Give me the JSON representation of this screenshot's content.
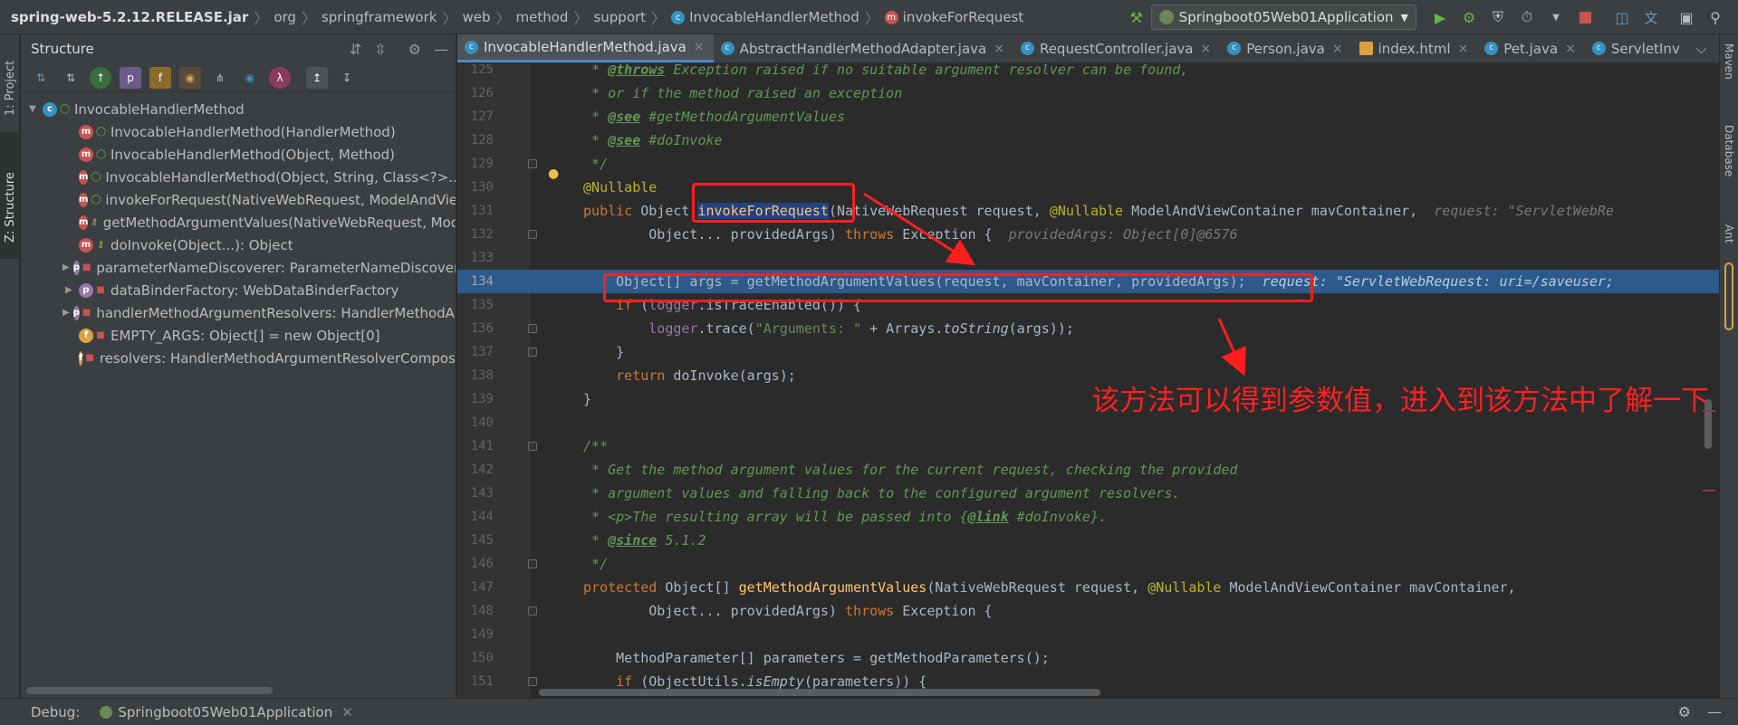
{
  "breadcrumbs": [
    "spring-web-5.2.12.RELEASE.jar",
    "org",
    "springframework",
    "web",
    "method",
    "support",
    "InvocableHandlerMethod",
    "invokeForRequest"
  ],
  "run_config": "Springboot05Web01Application",
  "left_tabs": [
    "1: Project",
    "Z: Structure"
  ],
  "right_tabs": [
    "Maven",
    "Database",
    "Ant"
  ],
  "structure": {
    "title": "Structure",
    "root": "InvocableHandlerMethod",
    "items": [
      {
        "badge": "m",
        "access": "public",
        "label": "InvocableHandlerMethod(HandlerMethod)"
      },
      {
        "badge": "m",
        "access": "public",
        "label": "InvocableHandlerMethod(Object, Method)"
      },
      {
        "badge": "m",
        "access": "public",
        "label": "InvocableHandlerMethod(Object, String, Class<?>...)"
      },
      {
        "badge": "m",
        "access": "public",
        "label": "invokeForRequest(NativeWebRequest, ModelAndViewContainer, Object...): Object"
      },
      {
        "badge": "m",
        "access": "protected",
        "label": "getMethodArgumentValues(NativeWebRequest, ModelAndViewContainer, Object...): Object[]"
      },
      {
        "badge": "m",
        "access": "protected",
        "label": "doInvoke(Object...): Object"
      },
      {
        "badge": "p",
        "access": "private",
        "label": "parameterNameDiscoverer: ParameterNameDiscoverer",
        "expandable": true
      },
      {
        "badge": "p",
        "access": "private",
        "label": "dataBinderFactory: WebDataBinderFactory",
        "expandable": true
      },
      {
        "badge": "p",
        "access": "private",
        "label": "handlerMethodArgumentResolvers: HandlerMethodArgumentResolverComposite",
        "expandable": true
      },
      {
        "badge": "f",
        "access": "private-static",
        "label": "EMPTY_ARGS: Object[] = new Object[0]"
      },
      {
        "badge": "f",
        "access": "private",
        "label": "resolvers: HandlerMethodArgumentResolverComposite"
      }
    ]
  },
  "tabs": [
    {
      "label": "InvocableHandlerMethod.java",
      "active": true
    },
    {
      "label": "AbstractHandlerMethodAdapter.java",
      "active": false
    },
    {
      "label": "RequestController.java",
      "active": false
    },
    {
      "label": "Person.java",
      "active": false
    },
    {
      "label": "index.html",
      "active": false
    },
    {
      "label": "Pet.java",
      "active": false
    },
    {
      "label": "ServletInv",
      "active": false
    }
  ],
  "editor": {
    "lines": [
      {
        "n": "125",
        "html": "<span class=\"cmt\">  * <span class=\"tag\">@throws</span> Exception raised if no suitable argument resolver can be found,</span>"
      },
      {
        "n": "126",
        "html": "<span class=\"cmt\">  * or if the method raised an exception</span>"
      },
      {
        "n": "127",
        "html": "<span class=\"cmt\">  * <span class=\"tag\">@see</span> #getMethodArgumentValues</span>"
      },
      {
        "n": "128",
        "html": "<span class=\"cmt\">  * <span class=\"tag\">@see</span> #doInvoke</span>"
      },
      {
        "n": "129",
        "html": "<span class=\"cmt\">  */</span>"
      },
      {
        "n": "130",
        "html": " <span class=\"ann\">@Nullable</span>"
      },
      {
        "n": "131",
        "html": " <span class=\"kw\">public</span> Object <span class=\"fn sel-word\">invokeForRequest</span>(NativeWebRequest request, <span class=\"ann\">@Nullable</span> ModelAndViewContainer mavContainer,  <span class=\"inl\">request: \"ServletWebRe</span>"
      },
      {
        "n": "132",
        "html": "         Object... providedArgs) <span class=\"kw\">throws</span> Exception {  <span class=\"inl\">providedArgs: Object[0]@6576</span>"
      },
      {
        "n": "133",
        "html": ""
      },
      {
        "n": "134",
        "html": "     Object[] args = getMethodArgumentValues(request, mavContainer, providedArgs);  <span class=\"inl-hl\">request: \"ServletWebRequest: uri=/saveuser;</span>",
        "highlight": true
      },
      {
        "n": "135",
        "html": "     <span class=\"kw\">if</span> (<span class=\"fld\">logger</span>.isTraceEnabled()) {"
      },
      {
        "n": "136",
        "html": "         <span class=\"fld\">logger</span>.trace(<span class=\"str\">\"Arguments: \"</span> + Arrays.<span class=\"ital\">toString</span>(args));"
      },
      {
        "n": "137",
        "html": "     }"
      },
      {
        "n": "138",
        "html": "     <span class=\"kw\">return</span> doInvoke(args);"
      },
      {
        "n": "139",
        "html": " }"
      },
      {
        "n": "140",
        "html": ""
      },
      {
        "n": "141",
        "html": " <span class=\"cmt\">/**</span>"
      },
      {
        "n": "142",
        "html": "<span class=\"cmt\">  * Get the method argument values for the current request, checking the provided</span>"
      },
      {
        "n": "143",
        "html": "<span class=\"cmt\">  * argument values and falling back to the configured argument resolvers.</span>"
      },
      {
        "n": "144",
        "html": "<span class=\"cmt\">  * &lt;p&gt;The resulting array will be passed into {<span class=\"tag\">@link</span> #doInvoke}.</span>"
      },
      {
        "n": "145",
        "html": "<span class=\"cmt\">  * <span class=\"tag\">@since</span> 5.1.2</span>"
      },
      {
        "n": "146",
        "html": "<span class=\"cmt\">  */</span>"
      },
      {
        "n": "147",
        "html": " <span class=\"kw\">protected</span> Object[] <span class=\"fn\">getMethodArgumentValues</span>(NativeWebRequest request, <span class=\"ann\">@Nullable</span> ModelAndViewContainer mavContainer,"
      },
      {
        "n": "148",
        "html": "         Object... providedArgs) <span class=\"kw\">throws</span> Exception {"
      },
      {
        "n": "149",
        "html": ""
      },
      {
        "n": "150",
        "html": "     MethodParameter[] parameters = getMethodParameters();"
      },
      {
        "n": "151",
        "html": "     <span class=\"kw\">if</span> (ObjectUtils.<span class=\"ital\">isEmpty</span>(parameters)) {"
      }
    ]
  },
  "annotation_text": "该方法可以得到参数值，进入到该方法中了解一下",
  "debug": {
    "label": "Debug:",
    "tab": "Springboot05Web01Application"
  },
  "colors": {
    "accent": "#4a88c7",
    "highlight_line": "#2d5a8a",
    "annotation_red": "#ff1e1e"
  }
}
